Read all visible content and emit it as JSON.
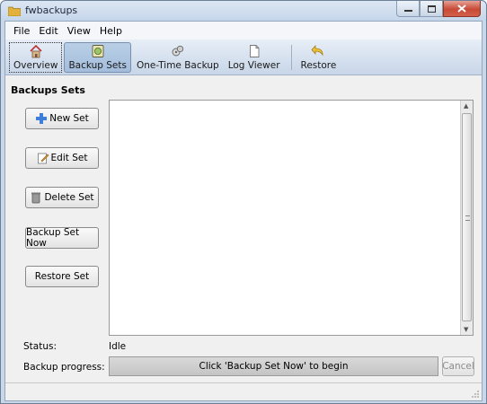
{
  "window": {
    "title": "fwbackups"
  },
  "menu": [
    "File",
    "Edit",
    "View",
    "Help"
  ],
  "toolbar": {
    "items": [
      {
        "label": "Overview",
        "icon": "home-icon"
      },
      {
        "label": "Backup Sets",
        "icon": "backup-sets-icon"
      },
      {
        "label": "One-Time Backup",
        "icon": "one-time-backup-icon"
      },
      {
        "label": "Log Viewer",
        "icon": "document-icon"
      },
      {
        "label": "Restore",
        "icon": "restore-icon"
      }
    ]
  },
  "section": {
    "title": "Backups Sets"
  },
  "side_buttons": {
    "new_set": "New Set",
    "edit_set": "Edit Set",
    "delete_set": "Delete Set",
    "backup_set_now": "Backup Set Now",
    "restore_set": "Restore Set"
  },
  "status": {
    "label": "Status:",
    "value": "Idle"
  },
  "progress": {
    "label": "Backup progress:",
    "text": "Click 'Backup Set Now' to begin",
    "cancel": "Cancel"
  },
  "colors": {
    "accent": "#4a78c2",
    "close": "#c74a35"
  }
}
